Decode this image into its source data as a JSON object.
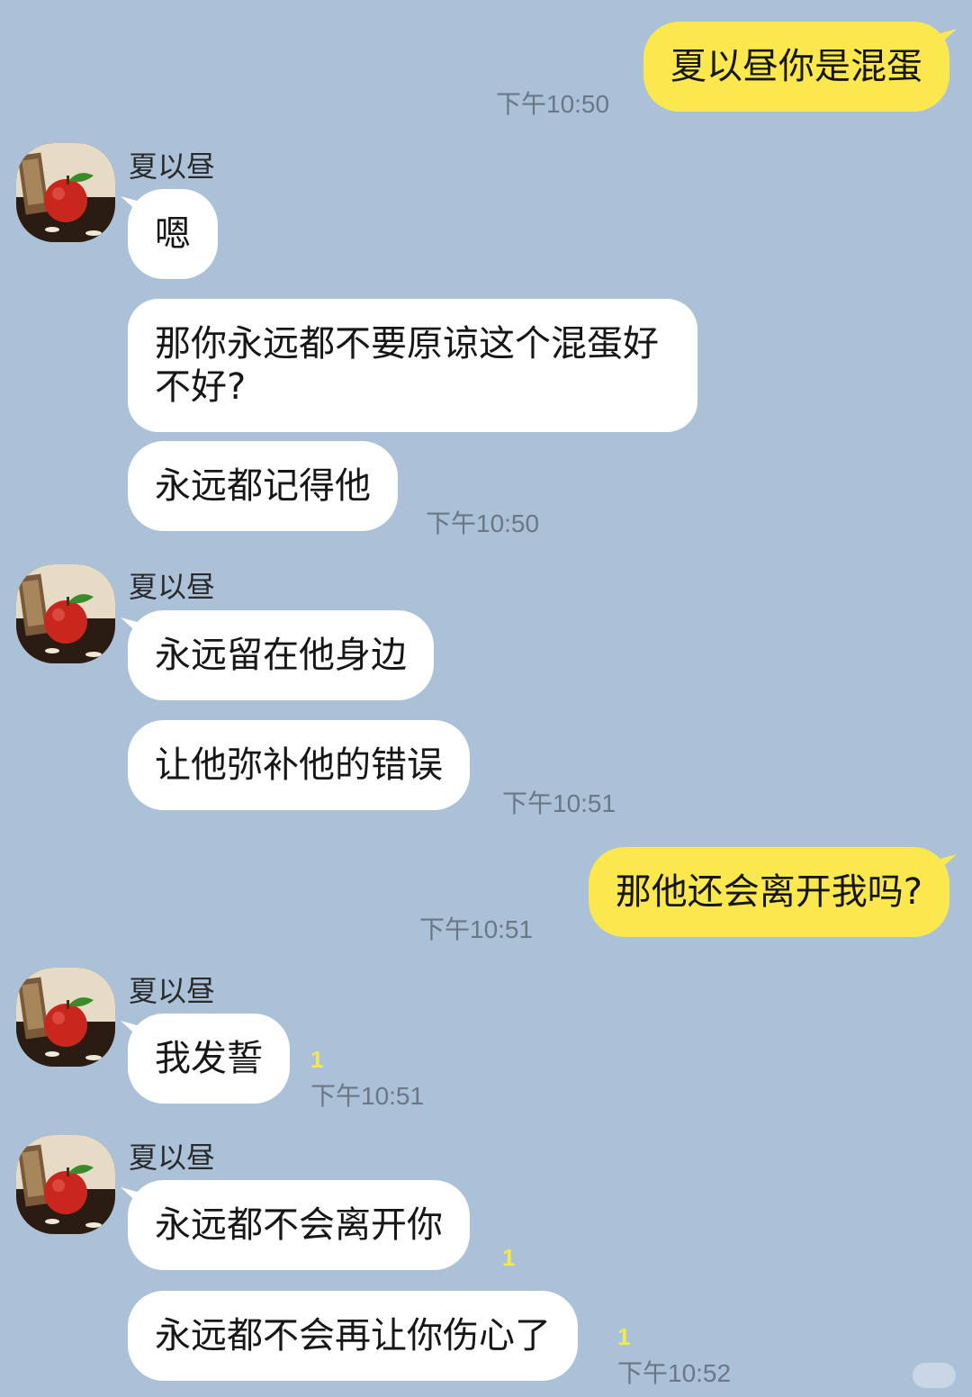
{
  "contact": {
    "name": "夏以昼"
  },
  "messages": [
    {
      "id": "m1",
      "dir": "out",
      "text": "夏以昼你是混蛋",
      "time": "下午10:50"
    },
    {
      "id": "m2",
      "dir": "in",
      "text": "嗯"
    },
    {
      "id": "m3",
      "dir": "in",
      "text": "那你永远都不要原谅这个混蛋好不好?"
    },
    {
      "id": "m4",
      "dir": "in",
      "text": "永远都记得他",
      "time": "下午10:50"
    },
    {
      "id": "m5",
      "dir": "in",
      "text": "永远留在他身边"
    },
    {
      "id": "m6",
      "dir": "in",
      "text": "让他弥补他的错误",
      "time": "下午10:51"
    },
    {
      "id": "m7",
      "dir": "out",
      "text": "那他还会离开我吗?",
      "time": "下午10:51"
    },
    {
      "id": "m8",
      "dir": "in",
      "text": "我发誓",
      "unread": "1",
      "time": "下午10:51"
    },
    {
      "id": "m9",
      "dir": "in",
      "text": "永远都不会离开你",
      "unread": "1"
    },
    {
      "id": "m10",
      "dir": "in",
      "text": "永远都不会再让你伤心了",
      "unread": "1",
      "time": "下午10:52"
    }
  ],
  "avatar_icon": "apple-photo-avatar",
  "colors": {
    "background": "#abc1d8",
    "incoming": "#ffffff",
    "outgoing": "#fbe74e",
    "unread": "#f4e84a"
  }
}
